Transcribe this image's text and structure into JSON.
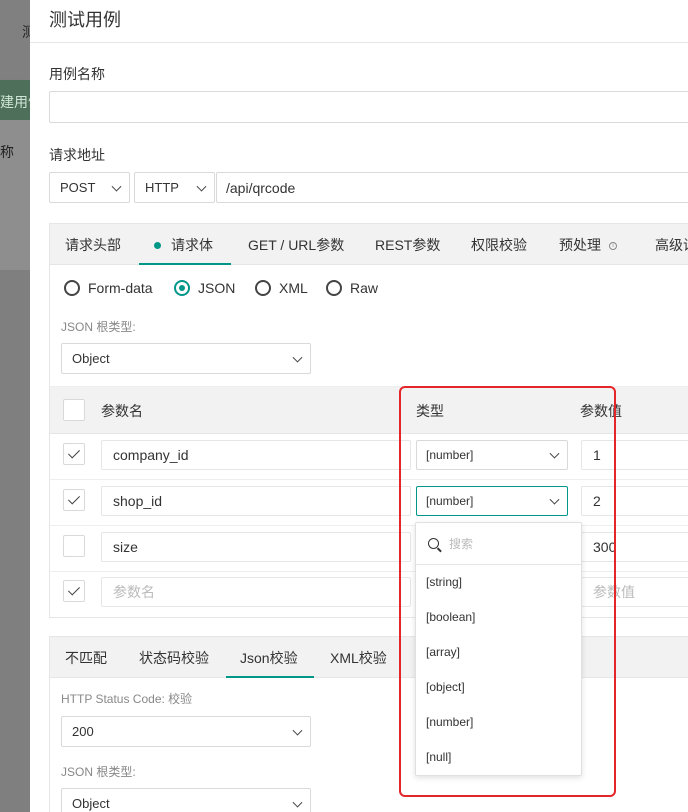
{
  "background": {
    "top_text": "测",
    "strip1_text": "建用例",
    "strip2_text": "称"
  },
  "modal": {
    "title": "测试用例",
    "case_name_label": "用例名称",
    "case_name_value": "",
    "url_label": "请求地址",
    "method": "POST",
    "protocol": "HTTP",
    "path": "/api/qrcode"
  },
  "request_tabs": [
    {
      "label": "请求头部"
    },
    {
      "label": "请求体",
      "active": true
    },
    {
      "label": "GET / URL参数"
    },
    {
      "label": "REST参数"
    },
    {
      "label": "权限校验"
    },
    {
      "label": "预处理"
    },
    {
      "label": "高级设"
    }
  ],
  "body_types": [
    {
      "label": "Form-data",
      "checked": false
    },
    {
      "label": "JSON",
      "checked": true
    },
    {
      "label": "XML",
      "checked": false
    },
    {
      "label": "Raw",
      "checked": false
    }
  ],
  "json_root_label": "JSON 根类型:",
  "json_root_value": "Object",
  "params_table": {
    "headers": {
      "name": "参数名",
      "type": "类型",
      "value": "参数值"
    },
    "rows": [
      {
        "checked": true,
        "name": "company_id",
        "type": "[number]",
        "value": "1"
      },
      {
        "checked": true,
        "name": "shop_id",
        "type": "[number]",
        "value": "2"
      },
      {
        "checked": false,
        "name": "size",
        "type": "",
        "value": "300"
      }
    ],
    "new_row": {
      "checked": true,
      "name_placeholder": "参数名",
      "value_placeholder": "参数值"
    }
  },
  "type_dropdown": {
    "search_placeholder": "搜索",
    "options": [
      "[string]",
      "[boolean]",
      "[array]",
      "[object]",
      "[number]",
      "[null]"
    ]
  },
  "validation_tabs": [
    {
      "label": "不匹配"
    },
    {
      "label": "状态码校验"
    },
    {
      "label": "Json校验",
      "active": true
    },
    {
      "label": "XML校验"
    }
  ],
  "http_status_label": "HTTP Status Code:  校验",
  "http_status_value": "200",
  "json_root_label2": "JSON 根类型:",
  "json_root_value2": "Object",
  "colors": {
    "accent": "#009688",
    "highlight": "#e4252a"
  }
}
